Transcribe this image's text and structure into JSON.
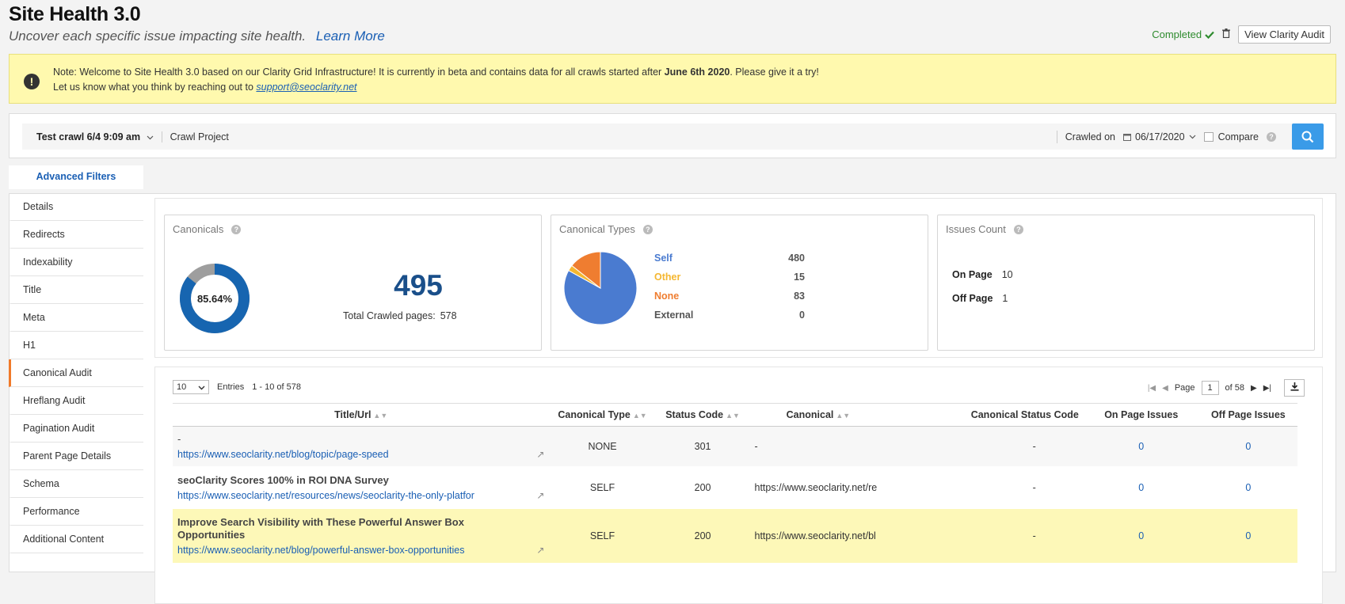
{
  "header": {
    "title": "Site Health 3.0",
    "subtitle": "Uncover each specific issue impacting site health.",
    "learn_more": "Learn More",
    "status": "Completed",
    "view_audit": "View Clarity Audit"
  },
  "note": {
    "line1_pre": "Note: Welcome to Site Health 3.0 based on our Clarity Grid Infrastructure! It is currently in beta and contains data for all crawls started after",
    "line1_date": "June 6th 2020",
    "line1_post": ". Please give it a try!",
    "line2_pre": "Let us know what you think by reaching out to",
    "email": "support@seoclarity.net"
  },
  "crawlbar": {
    "crawl": "Test crawl 6/4 9:09 am",
    "project": "Crawl Project",
    "crawled_on_label": "Crawled on",
    "date": "06/17/2020",
    "compare": "Compare"
  },
  "advanced_filters": "Advanced Filters",
  "sidebar": {
    "items": [
      {
        "label": "Details"
      },
      {
        "label": "Redirects"
      },
      {
        "label": "Indexability"
      },
      {
        "label": "Title"
      },
      {
        "label": "Meta"
      },
      {
        "label": "H1"
      },
      {
        "label": "Canonical Audit"
      },
      {
        "label": "Hreflang Audit"
      },
      {
        "label": "Pagination Audit"
      },
      {
        "label": "Parent Page Details"
      },
      {
        "label": "Schema"
      },
      {
        "label": "Performance"
      },
      {
        "label": "Additional Content"
      }
    ]
  },
  "canonicals": {
    "title": "Canonicals",
    "percent": "85.64%",
    "percent_value": 85.64,
    "count": "495",
    "total_label": "Total Crawled pages:",
    "total": "578"
  },
  "canonical_types": {
    "title": "Canonical Types",
    "rows": [
      {
        "label": "Self",
        "value": "480",
        "color": "#4a7bd0"
      },
      {
        "label": "Other",
        "value": "15",
        "color": "#f5b731"
      },
      {
        "label": "None",
        "value": "83",
        "color": "#ef7d30"
      },
      {
        "label": "External",
        "value": "0",
        "color": "#555555"
      }
    ]
  },
  "issues_count": {
    "title": "Issues Count",
    "on_page_label": "On Page",
    "on_page": "10",
    "off_page_label": "Off Page",
    "off_page": "1"
  },
  "table": {
    "page_size": "10",
    "entries_label": "Entries",
    "range": "1 - 10 of 578",
    "page_label": "Page",
    "page": "1",
    "of_pages": "of 58",
    "headers": {
      "title_url": "Title/Url",
      "canonical_type": "Canonical Type",
      "status_code": "Status Code",
      "canonical": "Canonical",
      "canonical_status": "Canonical Status Code",
      "on_page": "On Page Issues",
      "off_page": "Off Page Issues"
    },
    "rows": [
      {
        "title": "-",
        "url": "https://www.seoclarity.net/blog/topic/page-speed",
        "type": "NONE",
        "status": "301",
        "canonical": "-",
        "canonical_status": "-",
        "on": "0",
        "off": "0"
      },
      {
        "title": "seoClarity Scores 100% in ROI DNA Survey",
        "url": "https://www.seoclarity.net/resources/news/seoclarity-the-only-platfor",
        "type": "SELF",
        "status": "200",
        "canonical": "https://www.seoclarity.net/re",
        "canonical_status": "-",
        "on": "0",
        "off": "0"
      },
      {
        "title": "Improve Search Visibility with These Powerful Answer Box Opportunities",
        "url": "https://www.seoclarity.net/blog/powerful-answer-box-opportunities",
        "type": "SELF",
        "status": "200",
        "canonical": "https://www.seoclarity.net/bl",
        "canonical_status": "-",
        "on": "0",
        "off": "0"
      }
    ]
  }
}
